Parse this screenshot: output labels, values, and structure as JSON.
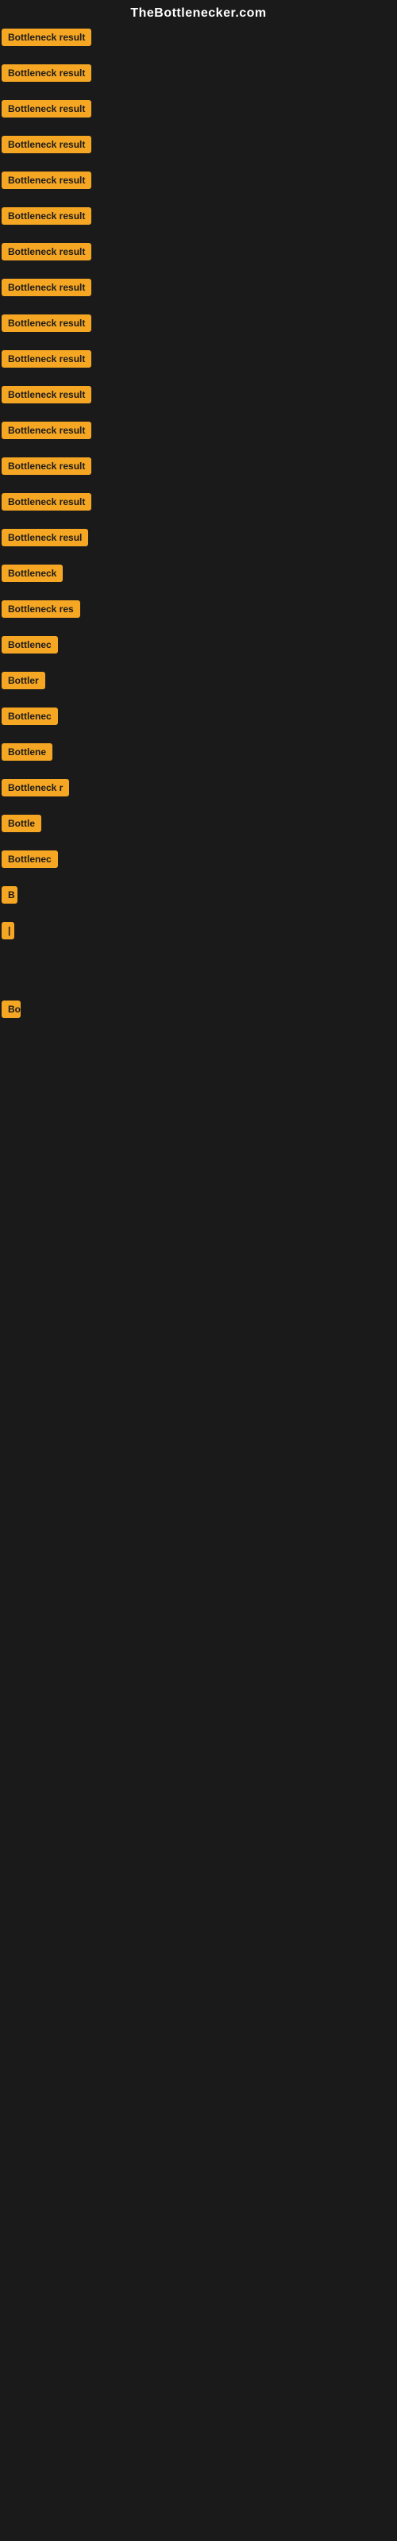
{
  "header": {
    "title": "TheBottlenecker.com"
  },
  "items": [
    {
      "label": "Bottleneck result",
      "width": 130
    },
    {
      "label": "Bottleneck result",
      "width": 130
    },
    {
      "label": "Bottleneck result",
      "width": 130
    },
    {
      "label": "Bottleneck result",
      "width": 130
    },
    {
      "label": "Bottleneck result",
      "width": 130
    },
    {
      "label": "Bottleneck result",
      "width": 130
    },
    {
      "label": "Bottleneck result",
      "width": 130
    },
    {
      "label": "Bottleneck result",
      "width": 130
    },
    {
      "label": "Bottleneck result",
      "width": 130
    },
    {
      "label": "Bottleneck result",
      "width": 130
    },
    {
      "label": "Bottleneck result",
      "width": 130
    },
    {
      "label": "Bottleneck result",
      "width": 130
    },
    {
      "label": "Bottleneck result",
      "width": 130
    },
    {
      "label": "Bottleneck result",
      "width": 130
    },
    {
      "label": "Bottleneck resul",
      "width": 120
    },
    {
      "label": "Bottleneck",
      "width": 85
    },
    {
      "label": "Bottleneck res",
      "width": 105
    },
    {
      "label": "Bottlenec",
      "width": 78
    },
    {
      "label": "Bottler",
      "width": 60
    },
    {
      "label": "Bottlenec",
      "width": 78
    },
    {
      "label": "Bottlene",
      "width": 72
    },
    {
      "label": "Bottleneck r",
      "width": 90
    },
    {
      "label": "Bottle",
      "width": 55
    },
    {
      "label": "Bottlenec",
      "width": 78
    },
    {
      "label": "B",
      "width": 20
    },
    {
      "label": "|",
      "width": 10
    },
    {
      "label": "",
      "width": 0
    },
    {
      "label": "",
      "width": 0
    },
    {
      "label": "",
      "width": 0
    },
    {
      "label": "Bo",
      "width": 24
    },
    {
      "label": "",
      "width": 0
    },
    {
      "label": "",
      "width": 0
    },
    {
      "label": "",
      "width": 0
    },
    {
      "label": "",
      "width": 0
    }
  ]
}
